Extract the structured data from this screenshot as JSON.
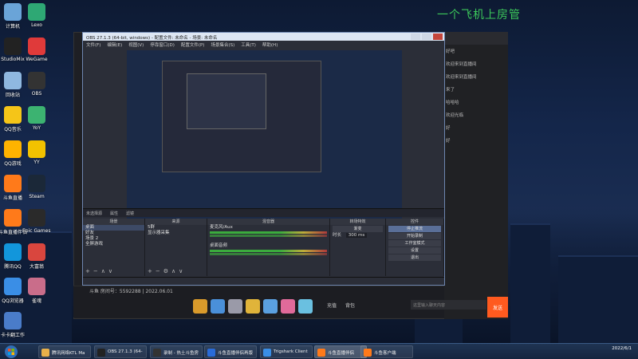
{
  "overlay_title": "一个飞机上房管",
  "desktop_icons": [
    {
      "label": "计算机",
      "color": "#6aa4d8"
    },
    {
      "label": "Lexo",
      "color": "#2ea874"
    },
    {
      "label": "StudioMix",
      "color": "#222222"
    },
    {
      "label": "WeGame",
      "color": "#e03a3a"
    },
    {
      "label": "回收站",
      "color": "#8fb8e0"
    },
    {
      "label": "OBS",
      "color": "#333333"
    },
    {
      "label": "QQ音乐",
      "color": "#f5c518"
    },
    {
      "label": "YoY",
      "color": "#3cb371"
    },
    {
      "label": "QQ游戏",
      "color": "#ffb300"
    },
    {
      "label": "YY",
      "color": "#f2c200"
    },
    {
      "label": "斗鱼直播",
      "color": "#ff7a1a"
    },
    {
      "label": "Steam",
      "color": "#1b2838"
    },
    {
      "label": "斗鱼直播伴侣",
      "color": "#ff7a1a"
    },
    {
      "label": "Epic Games Launcher",
      "color": "#2a2a2a"
    },
    {
      "label": "腾讯QQ",
      "color": "#1296db"
    },
    {
      "label": "大富翁",
      "color": "#d9463e"
    },
    {
      "label": "QQ浏览器",
      "color": "#3a8ee6"
    },
    {
      "label": "雀魂",
      "color": "#c96d8a"
    },
    {
      "label": "卡卡翻工作",
      "color": "#4a7cc9"
    }
  ],
  "obs": {
    "title": "OBS 27.1.3 (64-bit, windows) - 配置文件: 未命名 - 场景: 未命名",
    "menu": [
      "文件(F)",
      "编辑(E)",
      "视图(V)",
      "停靠窗口(D)",
      "配置文件(P)",
      "场景集合(S)",
      "工具(T)",
      "帮助(H)"
    ],
    "dock_bar": [
      "未选择源",
      "属性",
      "滤镜"
    ],
    "scenes": {
      "header": "场景",
      "items": [
        "桌面",
        "好友",
        "场景 2",
        "全屏游戏"
      ]
    },
    "sources": {
      "header": "来源",
      "items": [
        "5群",
        "显示器采集"
      ]
    },
    "mixer": {
      "header": "混音器",
      "tracks": [
        {
          "name": "麦克风/Aux",
          "db": ""
        },
        {
          "name": "桌面音频",
          "db": ""
        }
      ]
    },
    "transitions": {
      "header": "转场特效",
      "type": "渐变",
      "duration_label": "时长",
      "duration": "300 ms"
    },
    "controls": {
      "header": "控件",
      "buttons": [
        "停止推流",
        "开始录制",
        "工作室模式",
        "设置",
        "退出"
      ]
    },
    "status": ""
  },
  "client": {
    "bottom_info": "斗鱼 房间号：5592288 | 2022.06.01",
    "gift_colors": [
      "#d99a2b",
      "#4a90d9",
      "#9a9aa8",
      "#e0b43a",
      "#5aa0e0",
      "#e06a9a",
      "#6ac0e0"
    ],
    "chat_lines": [
      "好吧",
      "欢迎来到直播间",
      "欢迎来到直播间",
      "来了",
      "哈哈哈",
      "欢迎光临",
      "好",
      "好"
    ],
    "input_placeholder": "这里输入聊天内容",
    "send_label": "发送",
    "tags": [
      "充值",
      "背包"
    ]
  },
  "taskbar": {
    "items": [
      {
        "label": "腾讯网络KTL Ma",
        "color": "#e8b04a"
      },
      {
        "label": "OBS 27.1.3 (64-",
        "color": "#222222"
      },
      {
        "label": "录制 - 热土斗鱼房",
        "color": "#333333"
      },
      {
        "label": "斗鱼直播伴侣再版",
        "color": "#2a6bd8"
      },
      {
        "label": "Trigshark Client",
        "color": "#3a8ee6"
      },
      {
        "label": "斗鱼直播伴侣",
        "color": "#ff7a1a"
      },
      {
        "label": "斗鱼客户端",
        "color": "#ff7a1a"
      }
    ],
    "time": "",
    "date": "2022/6/1"
  }
}
